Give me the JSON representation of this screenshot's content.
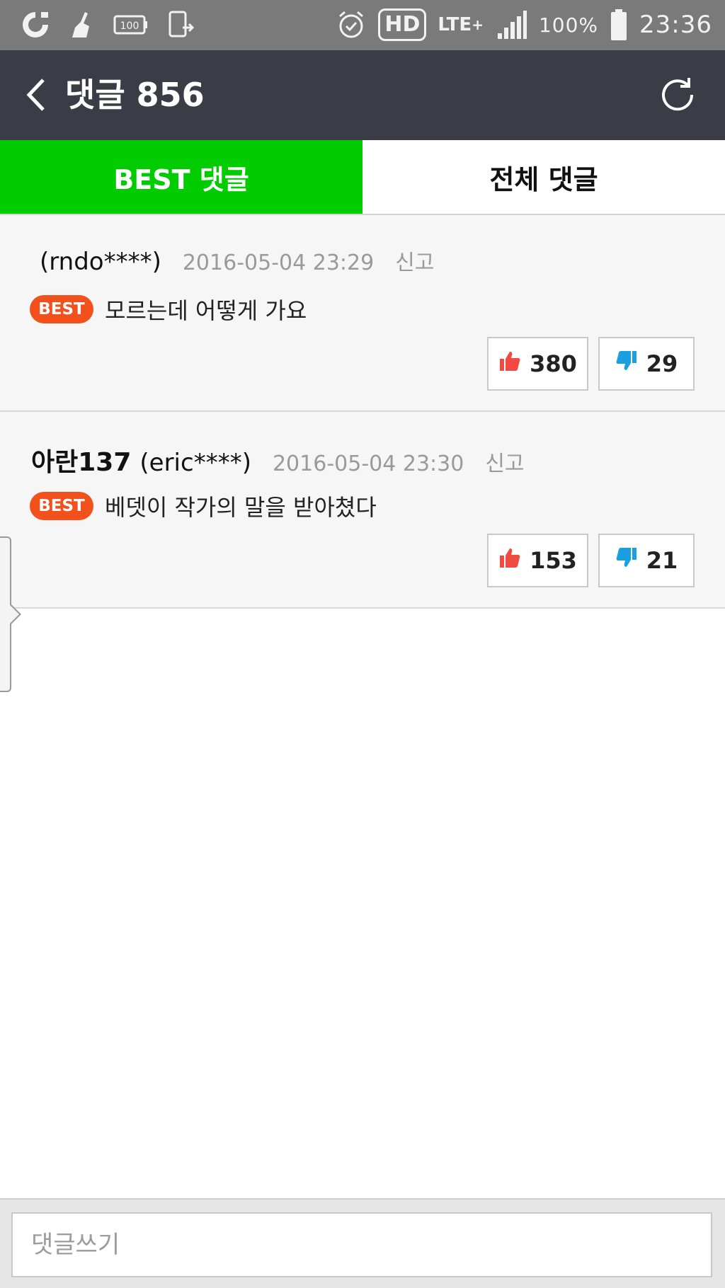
{
  "status_bar": {
    "icons_left": [
      "carrier-logo-icon",
      "cleaner-icon",
      "battery-100-icon",
      "phone-transfer-icon"
    ],
    "battery_small_label": "100",
    "icons_right": [
      "alarm-icon",
      "hd-voice-icon",
      "lte-icon",
      "signal-icon",
      "battery-icon"
    ],
    "hd_label": "HD",
    "lte_label": "LTE",
    "lte_plus": "+",
    "battery_percent": "100%",
    "time": "23:36",
    "colors": {
      "background": "#7a7a7a",
      "foreground": "#f2f2f2"
    }
  },
  "app_bar": {
    "title": "댓글 856",
    "back_icon": "chevron-left-icon",
    "refresh_icon": "refresh-icon",
    "colors": {
      "background": "#3a3d46",
      "foreground": "#ffffff"
    }
  },
  "tabs": [
    {
      "label": "BEST 댓글",
      "active": true
    },
    {
      "label": "전체 댓글",
      "active": false
    }
  ],
  "accent_color": "#00cc00",
  "comments": [
    {
      "nickname": "",
      "user_id": "(rndo****)",
      "date": "2016-05-04 23:29",
      "report_label": "신고",
      "badge": "BEST",
      "text": "모르는데 어떻게 가요",
      "likes": "380",
      "dislikes": "29"
    },
    {
      "nickname": "아란137",
      "user_id": "(eric****)",
      "date": "2016-05-04 23:30",
      "report_label": "신고",
      "badge": "BEST",
      "text": "베뎃이 작가의 말을 받아쳤다",
      "likes": "153",
      "dislikes": "21"
    }
  ],
  "badge_color": "#f2511b",
  "like_color": "#f04a43",
  "dislike_color": "#1a9fe0",
  "comment_input": {
    "placeholder": "댓글쓰기",
    "value": ""
  }
}
